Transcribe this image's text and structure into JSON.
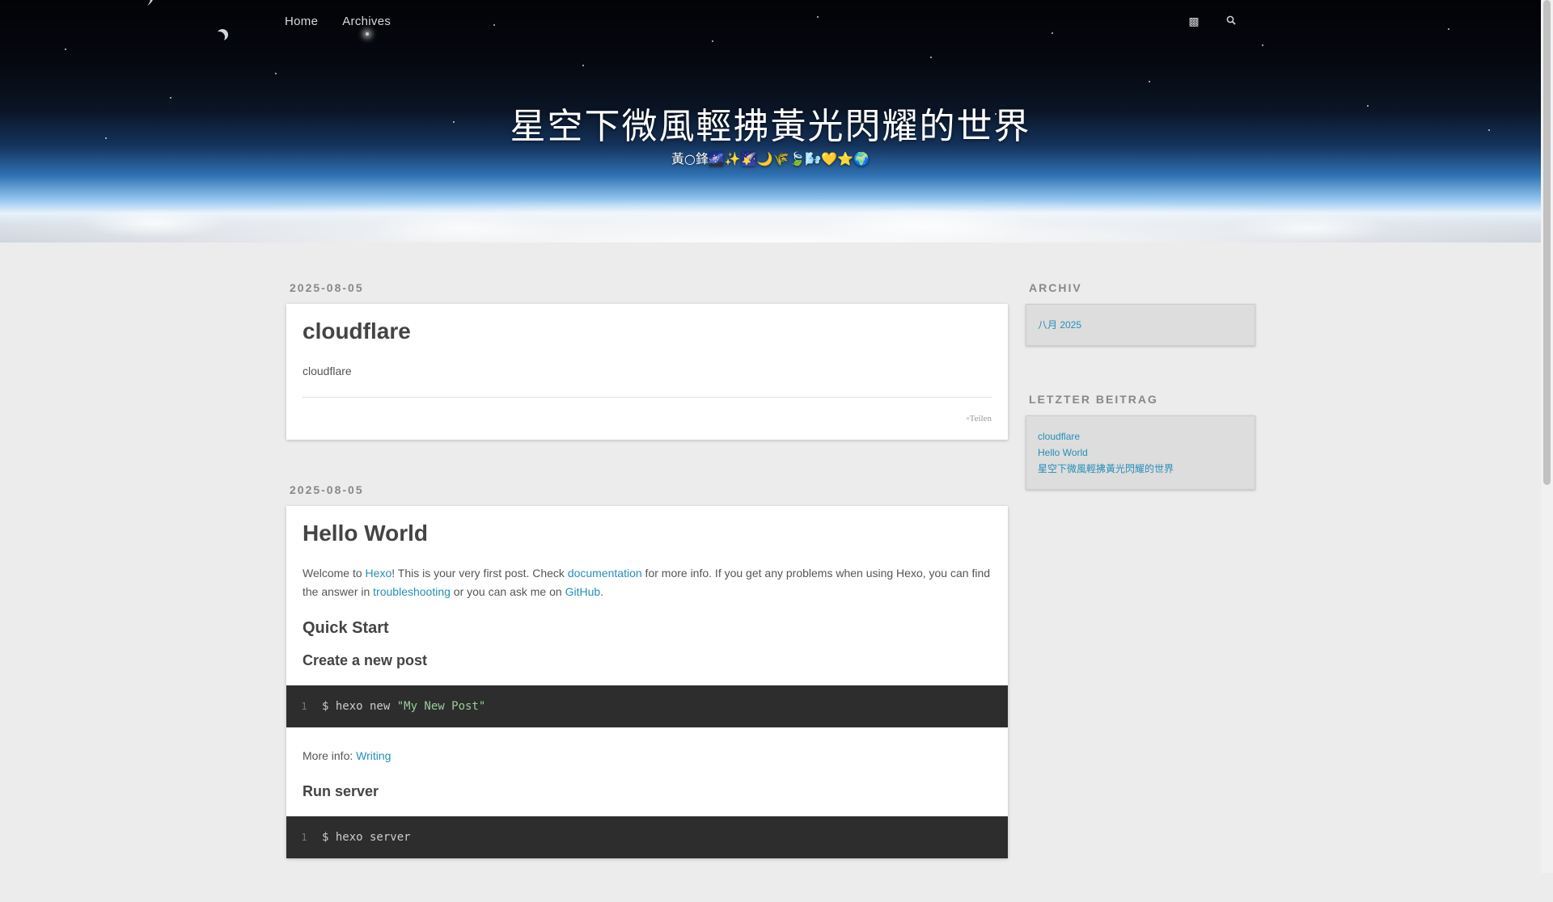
{
  "nav": {
    "items": [
      "Home",
      "Archives"
    ],
    "icons": [
      "rss-icon",
      "search-icon"
    ]
  },
  "site": {
    "title": "星空下微風輕拂黃光閃耀的世界",
    "subtitle": "黃○鋒🌌✨🌠🌙🌾🍃🌬️💛⭐🌍"
  },
  "posts": [
    {
      "date": "2025-08-05",
      "title": "cloudflare",
      "excerpt": "cloudflare",
      "share_label": "Teilen"
    },
    {
      "date": "2025-08-05",
      "title": "Hello World",
      "intro": {
        "p1": "Welcome to ",
        "link1": "Hexo",
        "p2": "! This is your very first post. Check ",
        "link2": "documentation",
        "p3": " for more info. If you get any problems when using Hexo, you can find the answer in ",
        "link3": "troubleshooting",
        "p4": " or you can ask me on ",
        "link4": "GitHub",
        "p5": "."
      },
      "quick_start": "Quick Start",
      "create_post": "Create a new post",
      "code1": {
        "line": "1",
        "cmd": "$ hexo new ",
        "str": "\"My New Post\""
      },
      "more_info_label": "More info: ",
      "more_info_link": "Writing",
      "run_server": "Run server",
      "code2": {
        "line": "1",
        "cmd": "$ hexo server"
      }
    }
  ],
  "sidebar": {
    "archive_title": "ARCHIV",
    "archive_items": [
      "八月 2025"
    ],
    "recent_title": "LETZTER BEITRAG",
    "recent_items": [
      "cloudflare",
      "Hello World",
      "星空下微風輕拂黃光閃耀的世界"
    ]
  },
  "colors": {
    "link": "#258fb8",
    "background": "#ececec",
    "code_bg": "#2d2d2d"
  }
}
